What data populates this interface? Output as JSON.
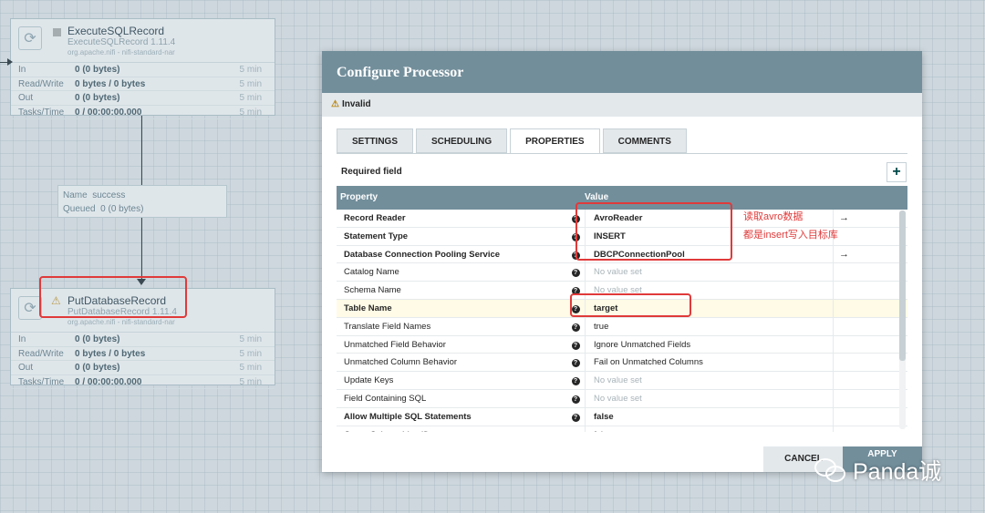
{
  "canvas": {
    "execute_proc": {
      "name": "ExecuteSQLRecord",
      "type": "ExecuteSQLRecord 1.11.4",
      "bundle": "org.apache.nifi - nifi-standard-nar",
      "rows": [
        {
          "key": "In",
          "value": "0 (0 bytes)",
          "time": "5 min"
        },
        {
          "key": "Read/Write",
          "value": "0 bytes / 0 bytes",
          "time": "5 min"
        },
        {
          "key": "Out",
          "value": "0 (0 bytes)",
          "time": "5 min"
        },
        {
          "key": "Tasks/Time",
          "value": "0 / 00:00:00.000",
          "time": "5 min"
        }
      ]
    },
    "connection": {
      "name_label": "Name",
      "name_value": "success",
      "queued_label": "Queued",
      "queued_value": "0 (0 bytes)"
    },
    "put_proc": {
      "name": "PutDatabaseRecord",
      "type": "PutDatabaseRecord 1.11.4",
      "bundle": "org.apache.nifi - nifi-standard-nar",
      "rows": [
        {
          "key": "In",
          "value": "0 (0 bytes)",
          "time": "5 min"
        },
        {
          "key": "Read/Write",
          "value": "0 bytes / 0 bytes",
          "time": "5 min"
        },
        {
          "key": "Out",
          "value": "0 (0 bytes)",
          "time": "5 min"
        },
        {
          "key": "Tasks/Time",
          "value": "0 / 00:00:00.000",
          "time": "5 min"
        }
      ]
    }
  },
  "dialog": {
    "title": "Configure Processor",
    "status": "Invalid",
    "tabs": [
      "SETTINGS",
      "SCHEDULING",
      "PROPERTIES",
      "COMMENTS"
    ],
    "active_tab": "PROPERTIES",
    "required_field": "Required field",
    "add_icon": "+",
    "header": {
      "property": "Property",
      "value": "Value"
    },
    "rows": [
      {
        "name": "Record Reader",
        "value": "AvroReader",
        "bold": true,
        "arrow": "→"
      },
      {
        "name": "Statement Type",
        "value": "INSERT",
        "bold": true,
        "arrow": ""
      },
      {
        "name": "Database Connection Pooling Service",
        "value": "DBCPConnectionPool",
        "bold": true,
        "arrow": "→"
      },
      {
        "name": "Catalog Name",
        "value": "No value set",
        "bold": false,
        "empty": true,
        "arrow": ""
      },
      {
        "name": "Schema Name",
        "value": "No value set",
        "bold": false,
        "empty": true,
        "arrow": ""
      },
      {
        "name": "Table Name",
        "value": "target",
        "bold": true,
        "selected": true,
        "arrow": ""
      },
      {
        "name": "Translate Field Names",
        "value": "true",
        "bold": false,
        "arrow": ""
      },
      {
        "name": "Unmatched Field Behavior",
        "value": "Ignore Unmatched Fields",
        "bold": false,
        "arrow": ""
      },
      {
        "name": "Unmatched Column Behavior",
        "value": "Fail on Unmatched Columns",
        "bold": false,
        "arrow": ""
      },
      {
        "name": "Update Keys",
        "value": "No value set",
        "bold": false,
        "empty": true,
        "arrow": ""
      },
      {
        "name": "Field Containing SQL",
        "value": "No value set",
        "bold": false,
        "empty": true,
        "arrow": ""
      },
      {
        "name": "Allow Multiple SQL Statements",
        "value": "false",
        "bold": true,
        "arrow": ""
      },
      {
        "name": "Quote Column Identifiers",
        "value": "false",
        "bold": false,
        "arrow": ""
      }
    ],
    "cancel": "CANCEL",
    "apply": "APPLY"
  },
  "annotations": {
    "line1": "读取avro数据",
    "line2": "都是insert写入目标库"
  },
  "watermark": "Panda诚",
  "colors": {
    "accent": "#728e9b",
    "annotation": "#e03a3a"
  }
}
